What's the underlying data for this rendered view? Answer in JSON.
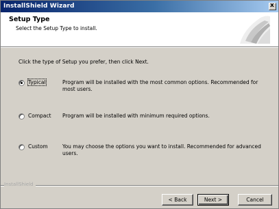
{
  "window": {
    "title": "InstallShield Wizard",
    "close_glyph": "x"
  },
  "header": {
    "title": "Setup Type",
    "subtitle": "Select the Setup Type to install."
  },
  "intro": "Click the type of Setup you prefer, then click Next.",
  "options": [
    {
      "label": "Typical",
      "selected": true,
      "description": "Program will be installed with the most common options.  Recommended for most users."
    },
    {
      "label": "Compact",
      "selected": false,
      "description": "Program will be installed with minimum required options."
    },
    {
      "label": "Custom",
      "selected": false,
      "description": "You may choose the options you want to install. Recommended for advanced users."
    }
  ],
  "footer": {
    "brand": "InstallShield",
    "back_label": "< Back",
    "next_label": "Next >",
    "cancel_label": "Cancel"
  },
  "colors": {
    "titlebar_start": "#08246b",
    "titlebar_end": "#a6caf0",
    "face": "#d4d0c8"
  }
}
